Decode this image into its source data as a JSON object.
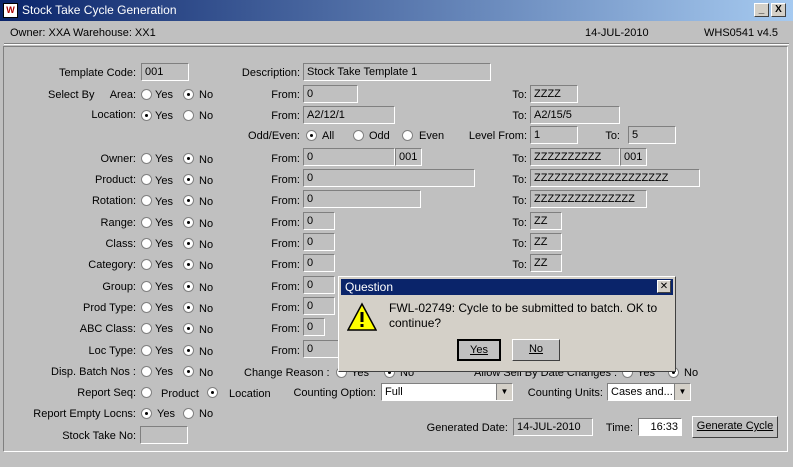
{
  "window": {
    "title": "Stock Take Cycle Generation",
    "minimize": "_",
    "close": "X"
  },
  "info": {
    "owner": "Owner:  XXA    Warehouse:  XX1",
    "date": "14-JUL-2010",
    "version": "WHS0541  v4.5"
  },
  "opts": {
    "yes": "Yes",
    "no": "No",
    "all": "All",
    "odd": "Odd",
    "even": "Even",
    "product": "Product",
    "location": "Location"
  },
  "labels": {
    "template_code": "Template Code:",
    "description": "Description:",
    "select_by": "Select By",
    "area": "Area:",
    "location": "Location:",
    "odd_even": "Odd/Even:",
    "level_from": "Level From:",
    "from": "From:",
    "to": "To:",
    "owner": "Owner:",
    "product": "Product:",
    "rotation": "Rotation:",
    "range": "Range:",
    "class": "Class:",
    "category": "Category:",
    "group": "Group:",
    "prod_type": "Prod Type:",
    "abc_class": "ABC Class:",
    "loc_type": "Loc Type:",
    "disp_batch": "Disp. Batch Nos :",
    "change_reason": "Change Reason :",
    "sell_by": "Allow Sell By Date Changes :",
    "report_seq": "Report Seq:",
    "counting_option": "Counting Option:",
    "counting_units": "Counting Units:",
    "report_empty": "Report Empty Locns:",
    "stock_take_no": "Stock Take No:",
    "generated_date": "Generated Date:",
    "time": "Time:"
  },
  "values": {
    "template_code": "001",
    "description": "Stock Take Template 1",
    "area_from": "0",
    "area_to": "ZZZZ",
    "loc_from": "A2/12/1",
    "loc_to": "A2/15/5",
    "level_from": "1",
    "level_to": "5",
    "owner_from": "0",
    "owner_from2": "001",
    "owner_to": "ZZZZZZZZZZ",
    "owner_to2": "001",
    "product_from": "0",
    "product_to": "ZZZZZZZZZZZZZZZZZZZZ",
    "rotation_from": "0",
    "rotation_to": "ZZZZZZZZZZZZZZZ",
    "range_from": "0",
    "range_to": "ZZ",
    "class_from": "0",
    "class_to": "ZZ",
    "category_from": "0",
    "category_to": "ZZ",
    "group_from": "0",
    "prodtype_from": "0",
    "abc_from": "0",
    "loctype_from": "0",
    "counting_option": "Full",
    "counting_units": "Cases and...",
    "stock_take_no": "",
    "generated_date": "14-JUL-2010",
    "time": "16:33"
  },
  "buttons": {
    "generate": "Generate Cycle"
  },
  "dialog": {
    "title": "Question",
    "message": "FWL-02749:  Cycle to be submitted to batch.  OK to continue?",
    "yes": "Yes",
    "no": "No"
  }
}
